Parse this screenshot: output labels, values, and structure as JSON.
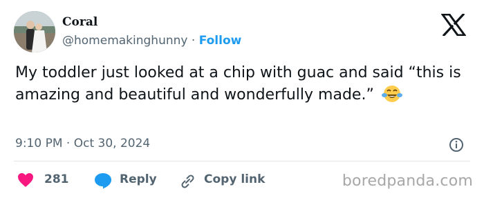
{
  "author": {
    "name": "Coral",
    "handle": "@homemakinghunny",
    "separator": "·",
    "follow_label": "Follow"
  },
  "tweet": {
    "text": "My toddler just looked at a chip with guac and said “this is amazing and beautiful and wonderfully made.”",
    "emoji": "face-with-tears-of-joy-icon"
  },
  "meta": {
    "time": "9:10 PM",
    "separator": "·",
    "date": "Oct 30, 2024"
  },
  "actions": {
    "likes_count": "281",
    "reply_label": "Reply",
    "copy_link_label": "Copy link"
  },
  "watermark": "boredpanda.com",
  "colors": {
    "follow_blue": "#1d9bf0",
    "like_pink": "#f91880",
    "reply_blue": "#1d9bf0",
    "muted_gray": "#536471"
  }
}
